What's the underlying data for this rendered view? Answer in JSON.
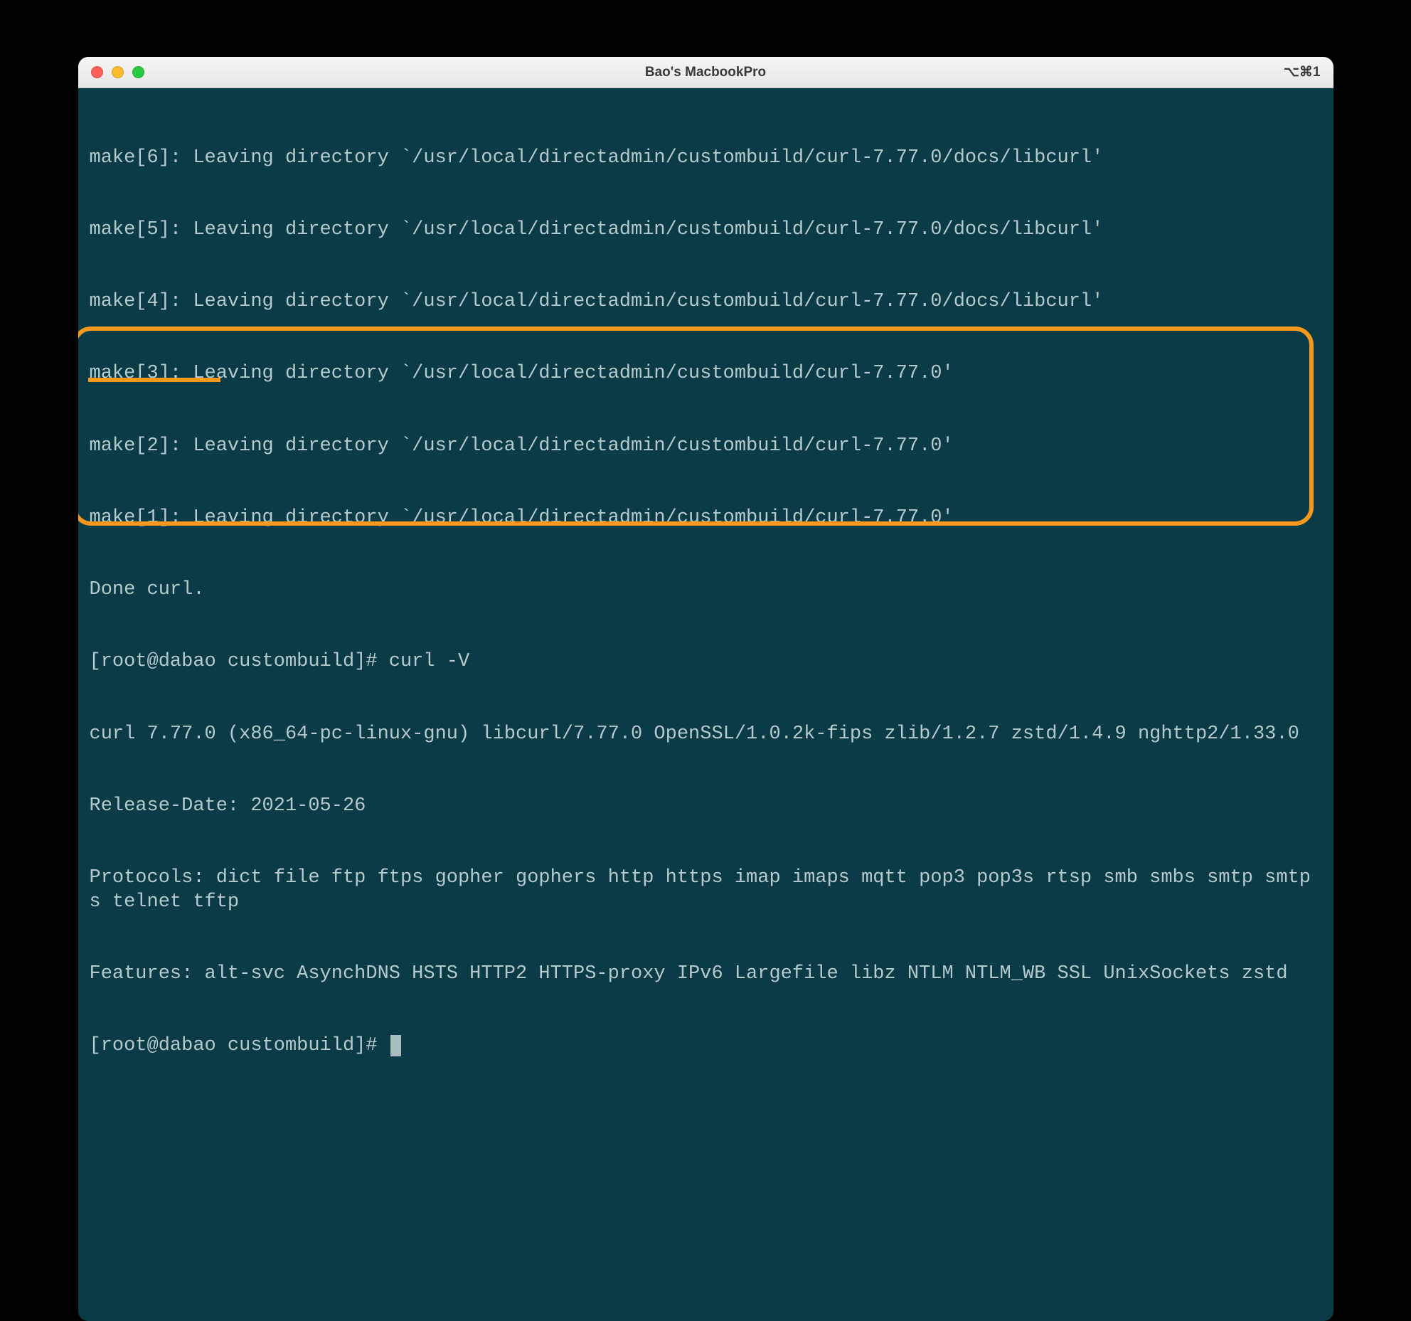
{
  "window": {
    "title": "Bao's MacbookPro",
    "shortcut": "⌥⌘1"
  },
  "terminal": {
    "lines": [
      "make[6]: Leaving directory `/usr/local/directadmin/custombuild/curl-7.77.0/docs/libcurl'",
      "make[5]: Leaving directory `/usr/local/directadmin/custombuild/curl-7.77.0/docs/libcurl'",
      "make[4]: Leaving directory `/usr/local/directadmin/custombuild/curl-7.77.0/docs/libcurl'",
      "make[3]: Leaving directory `/usr/local/directadmin/custombuild/curl-7.77.0'",
      "make[2]: Leaving directory `/usr/local/directadmin/custombuild/curl-7.77.0'",
      "make[1]: Leaving directory `/usr/local/directadmin/custombuild/curl-7.77.0'",
      "Done curl.",
      "[root@dabao custombuild]# curl -V",
      "curl 7.77.0 (x86_64-pc-linux-gnu) libcurl/7.77.0 OpenSSL/1.0.2k-fips zlib/1.2.7 zstd/1.4.9 nghttp2/1.33.0",
      "Release-Date: 2021-05-26",
      "Protocols: dict file ftp ftps gopher gophers http https imap imaps mqtt pop3 pop3s rtsp smb smbs smtp smtps telnet tftp ",
      "Features: alt-svc AsynchDNS HSTS HTTP2 HTTPS-proxy IPv6 Largefile libz NTLM NTLM_WB SSL UnixSockets zstd",
      "[root@dabao custombuild]# "
    ],
    "highlighted_text": "curl 7.77.0"
  },
  "annotation": {
    "box_color": "#f8991d",
    "underline_color": "#f8991d"
  }
}
